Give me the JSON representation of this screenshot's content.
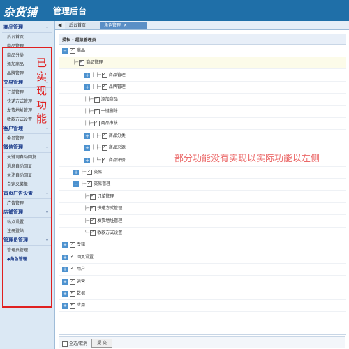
{
  "header": {
    "logo": "杂货铺",
    "subtitle": "管理后台"
  },
  "sidebar": {
    "groups": [
      {
        "title": "商品管理",
        "items": [
          "后台首页",
          "商品管理",
          "商品分类",
          "添加商品",
          "品牌管理"
        ]
      },
      {
        "title": "交易管理",
        "items": [
          "订单管理",
          "快递方式管理",
          "发货地址管理",
          "收款方式设置"
        ]
      },
      {
        "title": "客户管理",
        "items": [
          "会员管理"
        ]
      },
      {
        "title": "微信管理",
        "items": [
          "关键词自动回复",
          "消息自动回复",
          "关注自动回复",
          "自定义菜单"
        ]
      },
      {
        "title": "首页广告设置",
        "items": [
          "广告管理"
        ]
      },
      {
        "title": "店铺管理",
        "items": [
          "站点设置",
          "注册登陆"
        ]
      },
      {
        "title": "管理员管理",
        "items": [
          "管理员管理"
        ]
      }
    ],
    "active": "◆角色管理",
    "annotation": "已实现功能"
  },
  "tabs": {
    "items": [
      "后台首页",
      "角色管理"
    ],
    "close": "✕",
    "arrow": "◀"
  },
  "breadcrumb": "授权 - 超级管理员",
  "tree": [
    "商品",
    "商品管理",
    "商品管理",
    "品牌管理",
    "添加商品",
    "一键删除",
    "商品审核",
    "商品分类",
    "商品来源",
    "商品评价",
    "交易",
    "交易管理",
    "订单管理",
    "快递方式管理",
    "发货地址管理",
    "收款方式设置",
    "专辑",
    "回复设置",
    "用户",
    "运营",
    "数据",
    "应用"
  ],
  "annotation_overlay": "部分功能没有实现以实际功能以左侧",
  "footer": {
    "select_all": "全选/取消",
    "submit": "提 交"
  }
}
